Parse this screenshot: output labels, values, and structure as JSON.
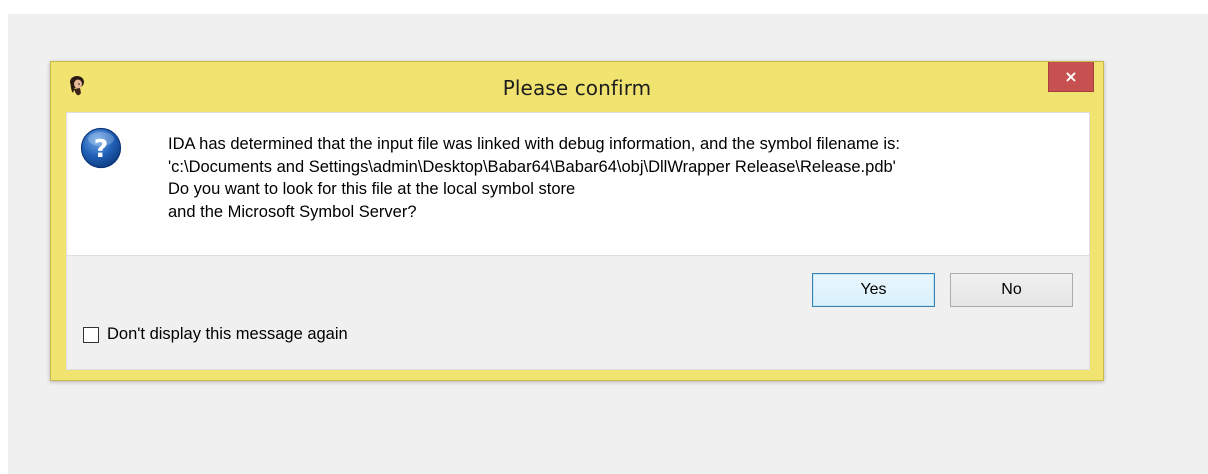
{
  "dialog": {
    "title": "Please confirm",
    "close_label": "×",
    "message_lines": [
      "IDA has determined that the input file was linked with debug information, and the symbol filename is:",
      "'c:\\Documents and Settings\\admin\\Desktop\\Babar64\\Babar64\\obj\\DllWrapper Release\\Release.pdb'",
      "Do you want to look for this file at the local symbol store",
      "and the Microsoft Symbol Server?"
    ],
    "yes_label": "Yes",
    "no_label": "No",
    "checkbox_label": "Don't display this message again",
    "checkbox_checked": false
  },
  "colors": {
    "frame": "#f0e36f",
    "close_button": "#c75050",
    "default_button_border": "#3c7fb1",
    "question_icon": "#1f5fb5"
  },
  "icons": {
    "app": "ida-app-icon",
    "message": "question-icon",
    "close": "close-icon"
  }
}
